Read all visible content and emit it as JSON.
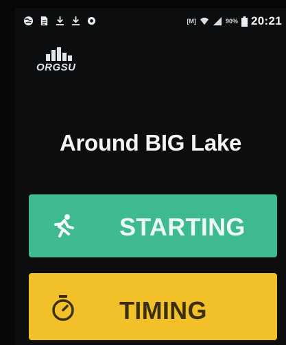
{
  "status_bar": {
    "left_icons": [
      "globe-icon",
      "document-icon",
      "download-icon",
      "download-icon",
      "settings-icon"
    ],
    "mobile_data_label": "M",
    "battery_percent": "90%",
    "time": "20:21"
  },
  "logo": {
    "text": "ORGSU"
  },
  "event": {
    "title": "Around BIG Lake"
  },
  "buttons": {
    "starting": {
      "label": "STARTING",
      "icon": "runner-icon",
      "color": "#3fb98f"
    },
    "timing": {
      "label": "TIMING",
      "icon": "stopwatch-icon",
      "color": "#f2c029"
    }
  }
}
